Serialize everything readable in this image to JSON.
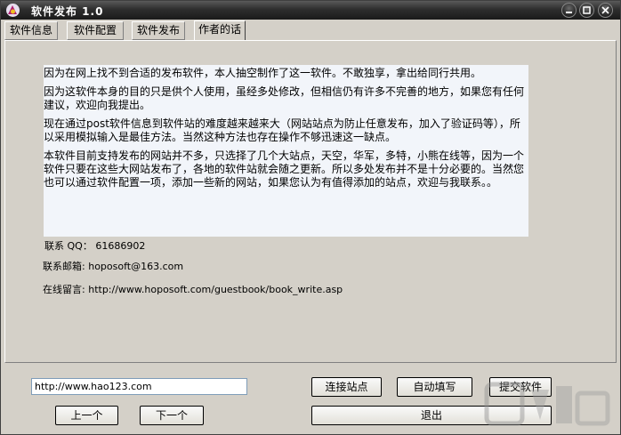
{
  "window": {
    "title": "软件发布 1.0"
  },
  "tabs": [
    {
      "label": "软件信息"
    },
    {
      "label": "软件配置"
    },
    {
      "label": "软件发布"
    },
    {
      "label": "作者的话"
    }
  ],
  "content": {
    "paragraphs": [
      "因为在网上找不到合适的发布软件，本人抽空制作了这一软件。不敢独享，拿出给同行共用。",
      "因为这软件本身的目的只是供个人使用，虽经多处修改，但相信仍有许多不完善的地方，如果您有任何建议，欢迎向我提出。",
      "现在通过post软件信息到软件站的难度越来越来大（网站站点为防止任意发布，加入了验证码等），所以采用模拟输入是最佳方法。当然这种方法也存在操作不够迅速这一缺点。",
      "本软件目前支持发布的网站并不多，只选择了几个大站点，天空，华军，多特，小熊在线等，因为一个软件只要在这些大网站发布了，各地的软件站就会随之更新。所以多处发布并不是十分必要的。当然您也可以通过软件配置一项，添加一些新的网站，如果您认为有值得添加的站点，欢迎与我联系。。"
    ],
    "qq_label": "联系 QQ：",
    "qq_value": "61686902",
    "email_label": "联系邮箱:",
    "email_value": "hoposoft@163.com",
    "guestbook_label": "在线留言:",
    "guestbook_value": "http://www.hoposoft.com/guestbook/book_write.asp"
  },
  "bottom": {
    "url_value": "http://www.hao123.com",
    "connect_label": "连接站点",
    "autofill_label": "自动填写",
    "submit_label": "提交软件",
    "prev_label": "上一个",
    "next_label": "下一个",
    "exit_label": "退出"
  },
  "colors": {
    "titlebar": "#2e2e2e",
    "face": "#d4d0c8",
    "textbox": "#f2f5fa"
  }
}
